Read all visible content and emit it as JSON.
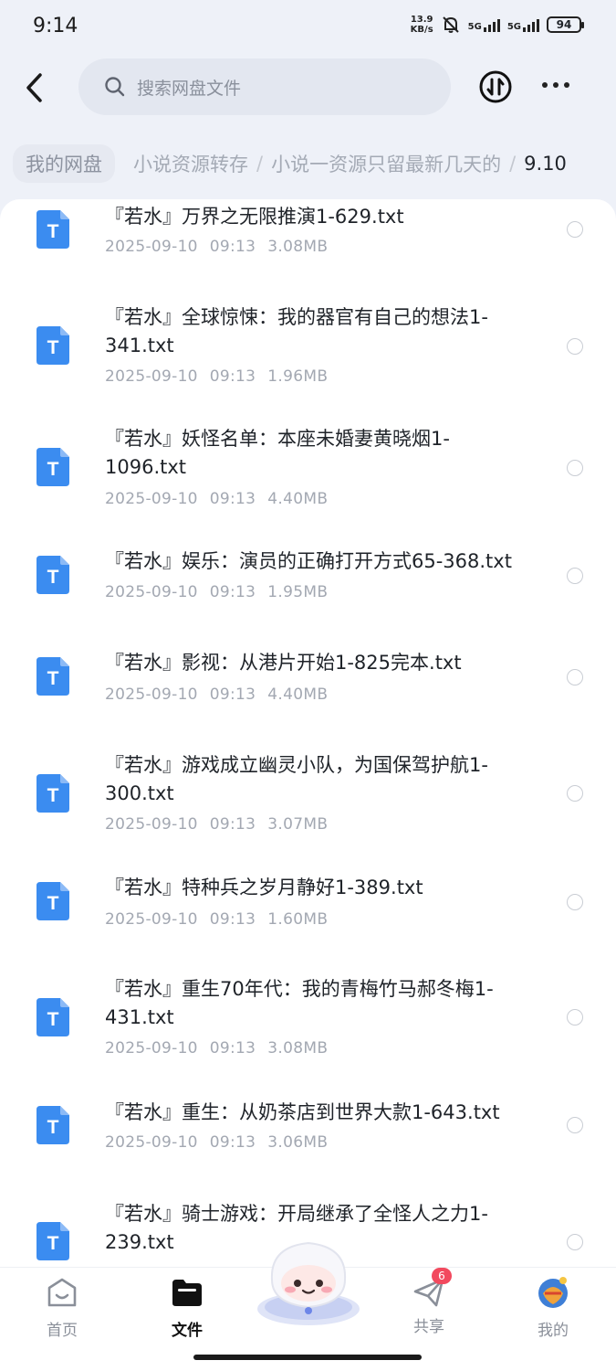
{
  "status_bar": {
    "time": "9:14",
    "speed_value": "13.9",
    "speed_unit": "KB/s",
    "network1": "5G",
    "network2": "5G",
    "battery": "94"
  },
  "header": {
    "search_placeholder": "搜索网盘文件",
    "back_icon": "chevron-left-icon",
    "transfer_icon": "transfer-icon",
    "more_icon": "more-icon"
  },
  "breadcrumb": {
    "items": [
      "我的网盘",
      "小说资源转存",
      "小说一资源只留最新几天的",
      "9.10"
    ],
    "separator": "/"
  },
  "files": [
    {
      "name": "『若水』万界之无限推演1-629.txt",
      "date": "2025-09-10",
      "time": "09:13",
      "size": "3.08MB"
    },
    {
      "name": "『若水』全球惊悚：我的器官有自己的想法1-341.txt",
      "date": "2025-09-10",
      "time": "09:13",
      "size": "1.96MB"
    },
    {
      "name": "『若水』妖怪名单：本座未婚妻黄晓烟1-1096.txt",
      "date": "2025-09-10",
      "time": "09:13",
      "size": "4.40MB"
    },
    {
      "name": "『若水』娱乐：演员的正确打开方式65-368.txt",
      "date": "2025-09-10",
      "time": "09:13",
      "size": "1.95MB"
    },
    {
      "name": "『若水』影视：从港片开始1-825完本.txt",
      "date": "2025-09-10",
      "time": "09:13",
      "size": "4.40MB"
    },
    {
      "name": "『若水』游戏成立幽灵小队，为国保驾护航1-300.txt",
      "date": "2025-09-10",
      "time": "09:13",
      "size": "3.07MB"
    },
    {
      "name": "『若水』特种兵之岁月静好1-389.txt",
      "date": "2025-09-10",
      "time": "09:13",
      "size": "1.60MB"
    },
    {
      "name": "『若水』重生70年代：我的青梅竹马郝冬梅1-431.txt",
      "date": "2025-09-10",
      "time": "09:13",
      "size": "3.08MB"
    },
    {
      "name": "『若水』重生：从奶茶店到世界大款1-643.txt",
      "date": "2025-09-10",
      "time": "09:13",
      "size": "3.06MB"
    },
    {
      "name": "『若水』骑士游戏：开局继承了全怪人之力1-239.txt",
      "date": "",
      "time": "",
      "size": ""
    }
  ],
  "file_icon_letter": "T",
  "colors": {
    "accent_blue": "#3b8cf0",
    "badge_red": "#f2495e",
    "page_bg": "#eef1f8"
  },
  "tabbar": {
    "tabs": [
      {
        "label": "首页",
        "icon": "home-icon"
      },
      {
        "label": "文件",
        "icon": "folder-icon"
      },
      {
        "label": "共享",
        "icon": "share-plane-icon",
        "badge": "6"
      },
      {
        "label": "我的",
        "icon": "avatar-icon"
      }
    ],
    "mascot_icon": "mascot-icon"
  }
}
